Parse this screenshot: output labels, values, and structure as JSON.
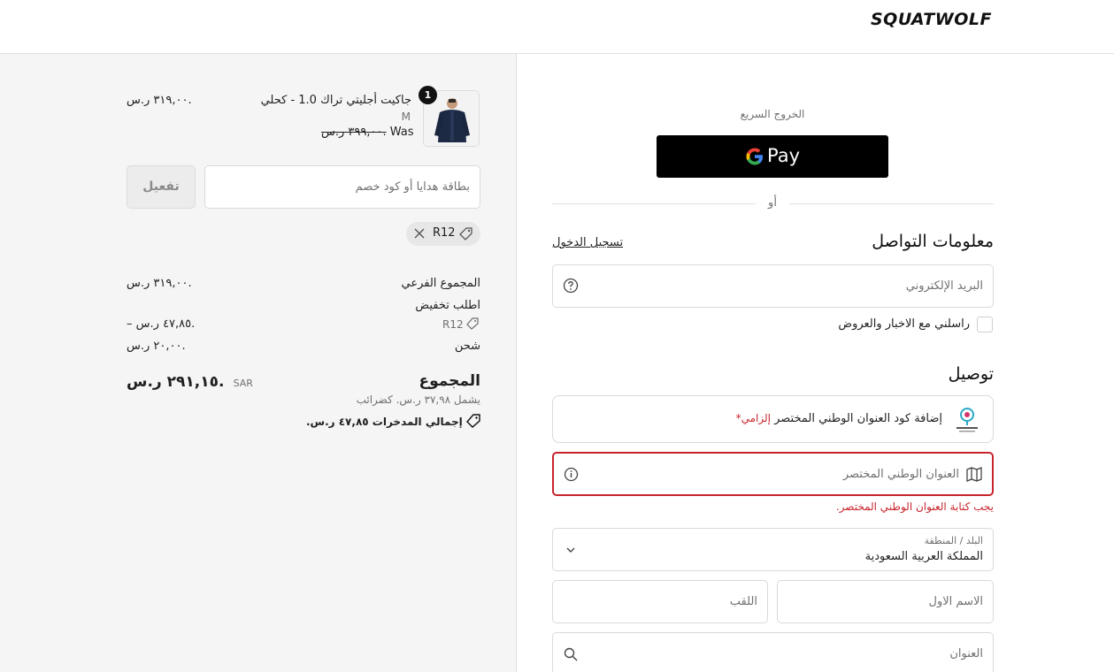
{
  "header": {
    "logo": "SQUATWOLF"
  },
  "summary": {
    "item": {
      "quantity": "1",
      "name": "جاكيت أجليتي تراك 1.0 - كحلي",
      "variant": "M",
      "was_label": "Was",
      "was_price": "٣٩٩,٠٠ ر.س.",
      "price": "٣١٩,٠٠ ر.س."
    },
    "discount": {
      "placeholder": "بطاقة هدايا أو كود خصم",
      "apply_label": "تفعيل",
      "applied_code": "R12"
    },
    "lines": {
      "subtotal_label": "المجموع الفرعي",
      "subtotal_value": "٣١٩,٠٠ ر.س.",
      "order_discount_label": "اطلب تخفيض",
      "order_discount_code": "R12",
      "order_discount_value": "– ٤٧,٨٥ ر.س.",
      "shipping_label": "شحن",
      "shipping_value": "٢٠,٠٠ ر.س."
    },
    "total": {
      "label": "المجموع",
      "currency": "SAR",
      "value": "٢٩١,١٥ ر.س.",
      "taxes_note": "يشمل ٣٧,٩٨ ر.س. كضرائب",
      "savings_label": "إجمالي المدخرات",
      "savings_value": "٤٧,٨٥ ر.س."
    }
  },
  "checkout": {
    "express_label": "الخروج السريع",
    "gpay_label": "Pay",
    "or_label": "أو",
    "contact": {
      "title": "معلومات التواصل",
      "login_link": "تسجيل الدخول",
      "email_placeholder": "البريد الإلكتروني",
      "newsletter_label": "راسلني مع الاخبار والعروض"
    },
    "delivery": {
      "title": "توصيل",
      "national_address_text": "إضافة كود العنوان الوطني المختصر",
      "required_label": "إلزامي*",
      "short_address_placeholder": "العنوان الوطني المختصر",
      "short_address_error": "يجب كتابة العنوان الوطني المختصر.",
      "country_label": "البلد / المنطقة",
      "country_value": "المملكة العربية السعودية",
      "first_name_placeholder": "الاسم الاول",
      "last_name_placeholder": "اللقب",
      "address_placeholder": "العنوان"
    }
  },
  "colors": {
    "error": "#c8242c",
    "summary_bg": "#f5f5f5",
    "button_black": "#000000"
  }
}
